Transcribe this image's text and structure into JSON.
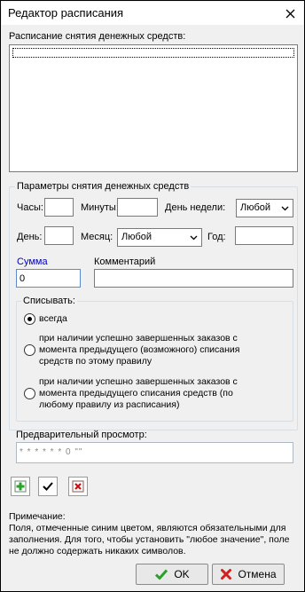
{
  "window": {
    "title": "Редактор расписания"
  },
  "schedule": {
    "label": "Расписание снятия денежных средств:"
  },
  "params": {
    "group_title": "Параметры снятия денежных средств",
    "hours_label": "Часы:",
    "hours_value": "",
    "minutes_label": "Минуты:",
    "minutes_value": "",
    "weekday_label": "День недели:",
    "weekday_value": "Любой",
    "day_label": "День:",
    "day_value": "",
    "month_label": "Месяц:",
    "month_value": "Любой",
    "year_label": "Год:",
    "year_value": ""
  },
  "sum": {
    "label": "Сумма",
    "value": "0",
    "color": "#0000c0"
  },
  "comment": {
    "label": "Комментарий",
    "value": ""
  },
  "debit": {
    "group_title": "Списывать:",
    "options": [
      {
        "text": "всегда",
        "selected": true
      },
      {
        "text": "при наличии успешно завершенных заказов с момента предыдущего (возможного) списания средств по этому правилу",
        "selected": false
      },
      {
        "text": "при наличии успешно завершенных заказов с момента предыдущего списания средств (по любому правилу из расписания)",
        "selected": false
      }
    ]
  },
  "preview": {
    "label": "Предварительный просмотр:",
    "value": "* * * * * * 0 \"\""
  },
  "toolbar": {
    "add_icon": "add-green-plus-icon",
    "apply_icon": "checkmark-icon",
    "delete_icon": "delete-red-x-icon"
  },
  "note": {
    "title": "Примечание:",
    "text": "Поля, отмеченные синим цветом, являются обязательными для заполнения. Для того, чтобы установить \"любое значение\", поле не должно содержать никаких символов."
  },
  "buttons": {
    "ok_label": "OK",
    "cancel_label": "Отмена"
  }
}
